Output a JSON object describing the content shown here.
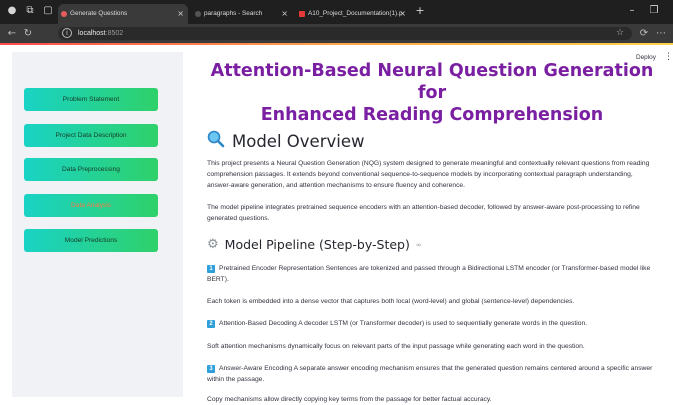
{
  "browser": {
    "tabs": [
      {
        "label": "Generate Questions",
        "active": true,
        "favicon_color": "#e65b5b"
      },
      {
        "label": "paragraphs - Search",
        "active": false,
        "favicon_color": "#555555"
      },
      {
        "label": "A10_Project_Documentation(1).p",
        "active": false,
        "favicon_color": "#e53935"
      }
    ],
    "new_tab_label": "+",
    "close_glyph": "×",
    "url_host": "localhost",
    "url_port": ":8502",
    "window_controls": {
      "minimize": "–",
      "restore": "❐"
    }
  },
  "header": {
    "deploy_label": "Deploy",
    "menu_glyph": "⋮"
  },
  "sidebar": {
    "items": [
      {
        "label": "Problem Statement",
        "selected": false
      },
      {
        "label": "Project Data Description",
        "selected": false
      },
      {
        "label": "Data Preprocessing",
        "selected": false
      },
      {
        "label": "Data Analysis",
        "selected": true
      },
      {
        "label": "Model Predictions",
        "selected": false
      }
    ]
  },
  "main": {
    "title_line1": "Attention-Based Neural Question Generation for",
    "title_line2": "Enhanced Reading Comprehension",
    "overview_heading": "Model Overview",
    "overview_icon": "magnifier-icon",
    "overview_p1": "This project presents a Neural Question Generation (NQG) system designed to generate meaningful and contextually relevant questions from reading comprehension passages. It extends beyond conventional sequence-to-sequence models by incorporating contextual paragraph understanding, answer-aware generation, and attention mechanisms to ensure fluency and coherence.",
    "overview_p2": "The model pipeline integrates pretrained sequence encoders with an attention-based decoder, followed by answer-aware post-processing to refine generated questions.",
    "pipeline_heading": "Model Pipeline (Step-by-Step)",
    "pipeline_icon": "gear-icon",
    "pipeline_link_glyph": "∞",
    "steps": [
      {
        "num": "1",
        "text": "Pretrained Encoder Representation Sentences are tokenized and passed through a Bidirectional LSTM encoder (or Transformer-based model like BERT)."
      },
      {
        "num": "",
        "text": "Each token is embedded into a dense vector that captures both local (word-level) and global (sentence-level) dependencies."
      },
      {
        "num": "2",
        "text": "Attention-Based Decoding A decoder LSTM (or Transformer decoder) is used to sequentially generate words in the question."
      },
      {
        "num": "",
        "text": "Soft attention mechanisms dynamically focus on relevant parts of the input passage while generating each word in the question."
      },
      {
        "num": "3",
        "text": "Answer-Aware Encoding A separate answer encoding mechanism ensures that the generated question remains centered around a specific answer within the passage."
      },
      {
        "num": "",
        "text": "Copy mechanisms allow directly copying key terms from the passage for better factual accuracy."
      }
    ]
  },
  "colors": {
    "title": "#7b1fa2",
    "button_gradient_start": "#19d3c5",
    "button_gradient_end": "#2fd16a",
    "selected_text": "#ff7a45",
    "badge": "#2e9fd8"
  }
}
